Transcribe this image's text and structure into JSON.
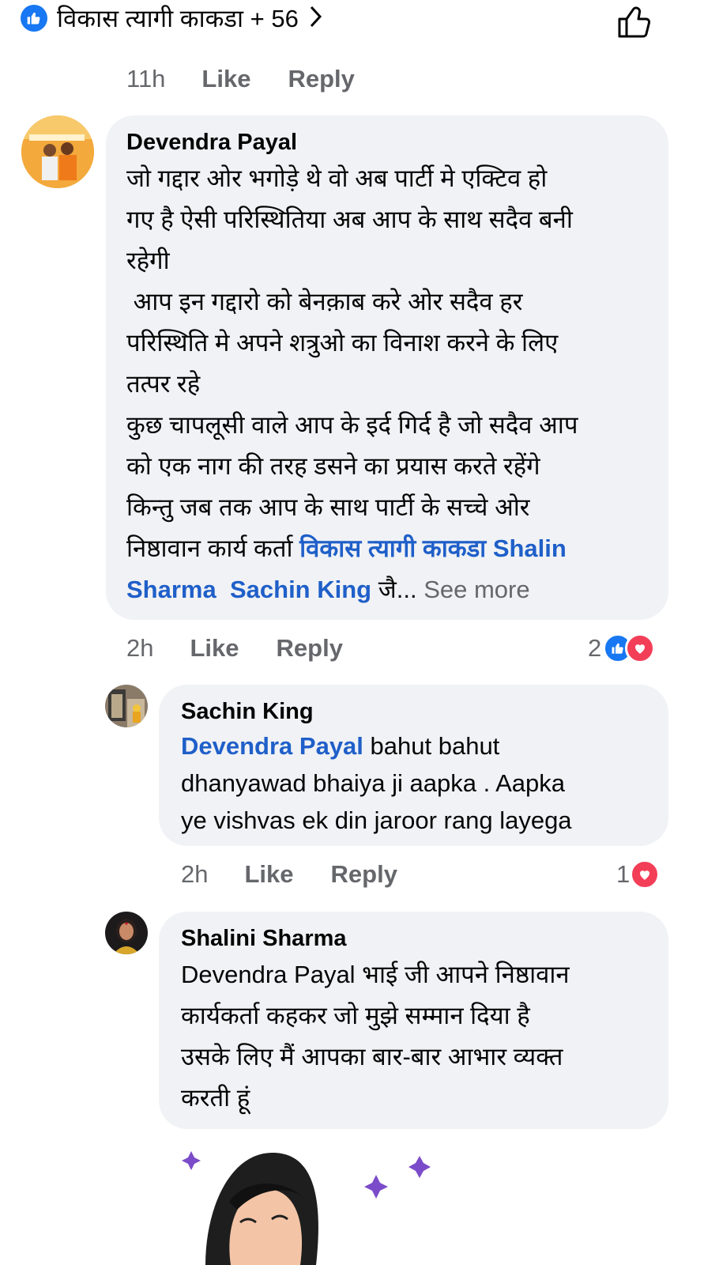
{
  "top": {
    "reactors_text": "विकास त्यागी काकडा + 56"
  },
  "parent_meta": {
    "time": "11h",
    "like": "Like",
    "reply": "Reply"
  },
  "comment1": {
    "author": "Devendra Payal",
    "lines": [
      "जो गद्दार ओर भगोड़े थे वो अब पार्टी मे एक्टिव हो",
      "गए है ऐसी परिस्थितिया अब आप के साथ सदैव बनी",
      "रहेगी",
      " आप इन गद्दारो को बेनक़ाब करे ओर सदैव हर",
      "परिस्थिति मे अपने शत्रुओ का विनाश करने के लिए",
      "तत्पर रहे",
      "कुछ चापलूसी वाले आप के इर्द गिर्द है जो सदैव आप",
      "को एक नाग की तरह डसने का प्रयास करते रहेंगे",
      "किन्तु जब तक आप के साथ पार्टी के सच्चे ओर"
    ],
    "line10_prefix": "निष्ठावान कार्य कर्ता ",
    "mention1": "विकास त्यागी काकडा",
    "mention2a": "Shalin",
    "mention2b": "Sharma",
    "mention3": "Sachin King",
    "tail": " जै...",
    "see_more": "See more",
    "time": "2h",
    "like": "Like",
    "reply": "Reply",
    "reaction_count": "2"
  },
  "reply1": {
    "author": "Sachin King",
    "mention": "Devendra Payal",
    "line1_rest": " bahut bahut",
    "line2": "dhanyawad bhaiya ji aapka . Aapka",
    "line3": "ye vishvas ek din jaroor rang layega",
    "time": "2h",
    "like": "Like",
    "reply": "Reply",
    "reaction_count": "1"
  },
  "reply2": {
    "author": "Shalini Sharma",
    "lines": [
      "Devendra Payal भाई जी आपने निष्ठावान",
      "कार्यकर्ता कहकर जो मुझे सम्मान दिया है",
      "उसके लिए मैं आपका बार-बार आभार व्यक्त",
      "करती हूं"
    ]
  },
  "colors": {
    "accent": "#1877f2",
    "love": "#f33e58",
    "mention": "#1f5fc9",
    "bubble": "#f0f2f5",
    "meta": "#65676b"
  }
}
